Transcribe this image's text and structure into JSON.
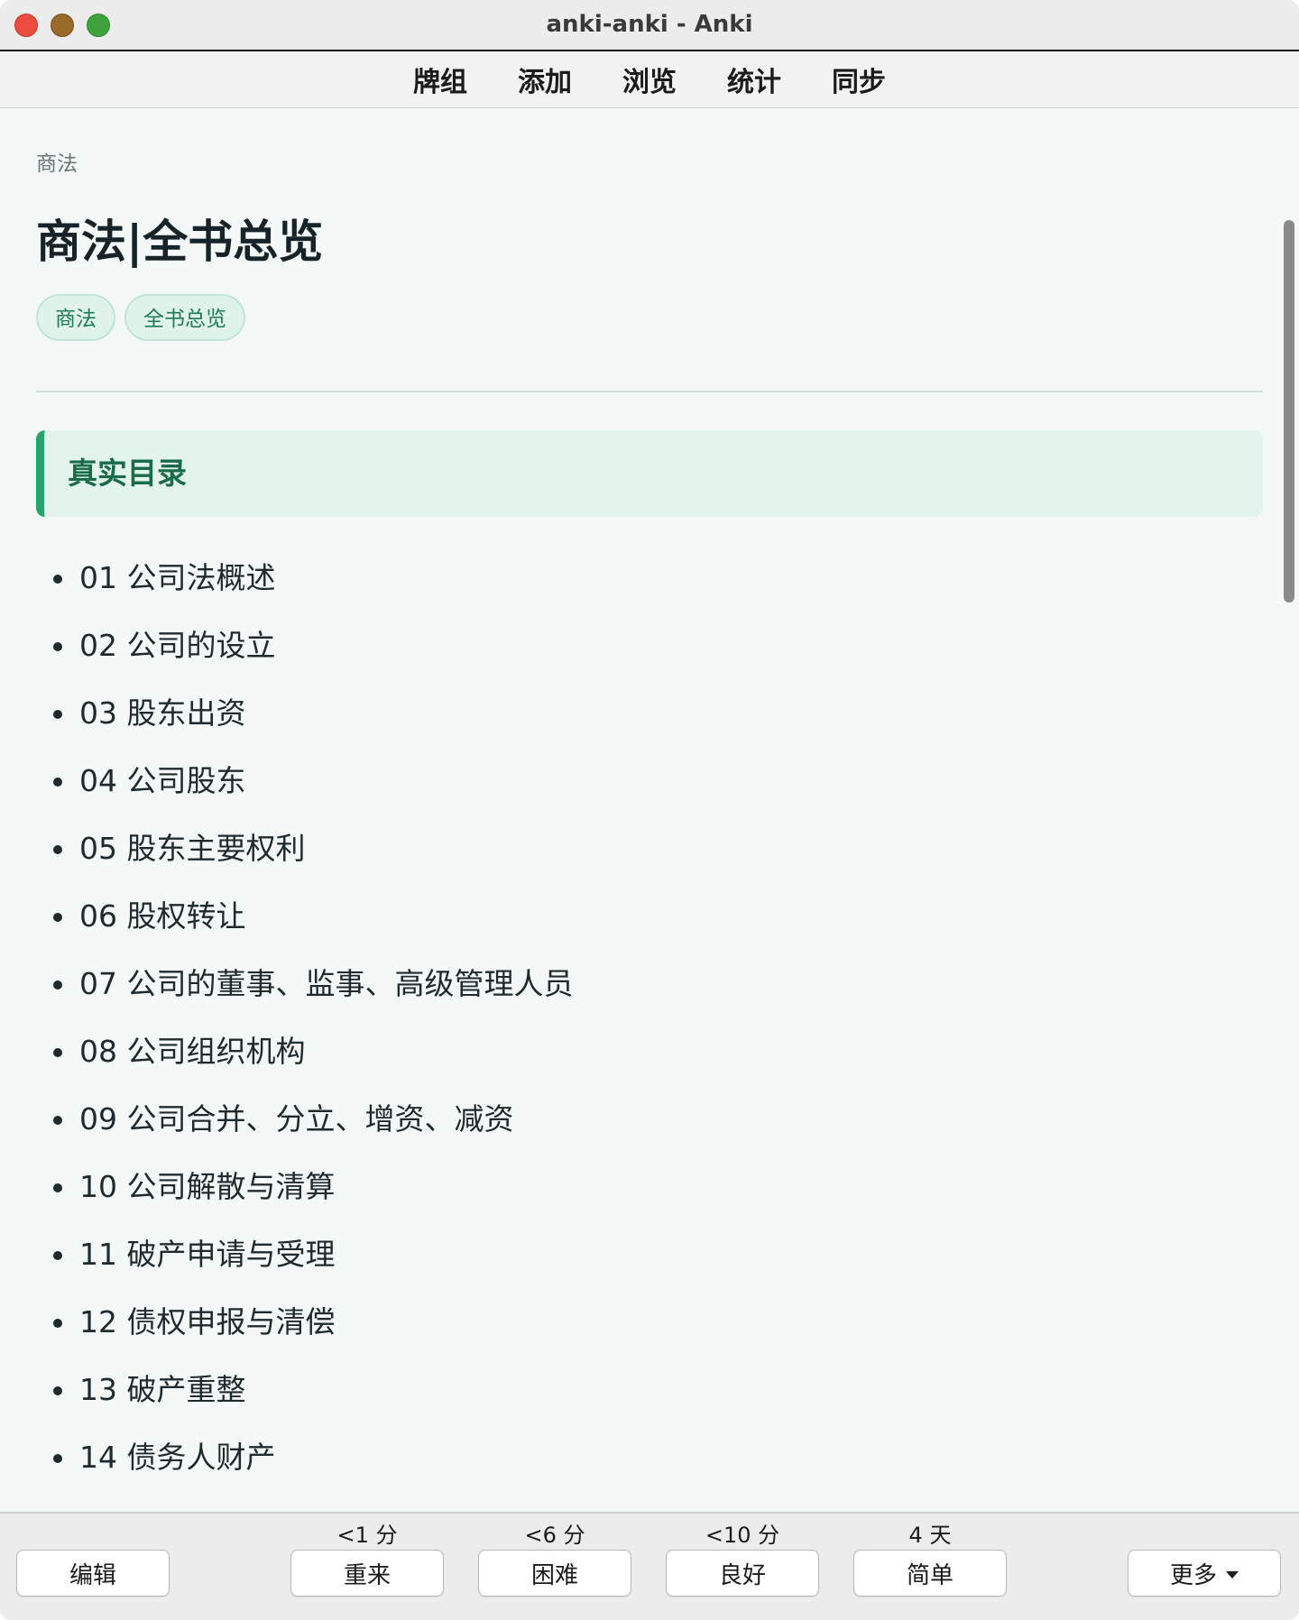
{
  "window": {
    "title": "anki-anki - Anki"
  },
  "toolbar": {
    "items": [
      "牌组",
      "添加",
      "浏览",
      "统计",
      "同步"
    ]
  },
  "card": {
    "breadcrumb": "商法",
    "title": "商法|全书总览",
    "tags": [
      "商法",
      "全书总览"
    ],
    "section_heading": "真实目录",
    "toc": [
      "01 公司法概述",
      "02 公司的设立",
      "03 股东出资",
      "04 公司股东",
      "05 股东主要权利",
      "06 股权转让",
      "07 公司的董事、监事、高级管理人员",
      "08 公司组织机构",
      "09 公司合并、分立、增资、减资",
      "10 公司解散与清算",
      "11 破产申请与受理",
      "12 债权申报与清偿",
      "13 破产重整",
      "14 债务人财产"
    ]
  },
  "answer_bar": {
    "edit_label": "编辑",
    "more_label": "更多",
    "buttons": [
      {
        "label": "重来",
        "interval": "<1 分"
      },
      {
        "label": "困难",
        "interval": "<6 分"
      },
      {
        "label": "良好",
        "interval": "<10 分"
      },
      {
        "label": "简单",
        "interval": "4 天"
      }
    ]
  },
  "colors": {
    "accent": "#27a46e",
    "callout_bg": "#e3f4ec",
    "tag_bg": "#dff3ea",
    "tag_text": "#1f7a55",
    "content_bg": "#f4f9f8"
  }
}
